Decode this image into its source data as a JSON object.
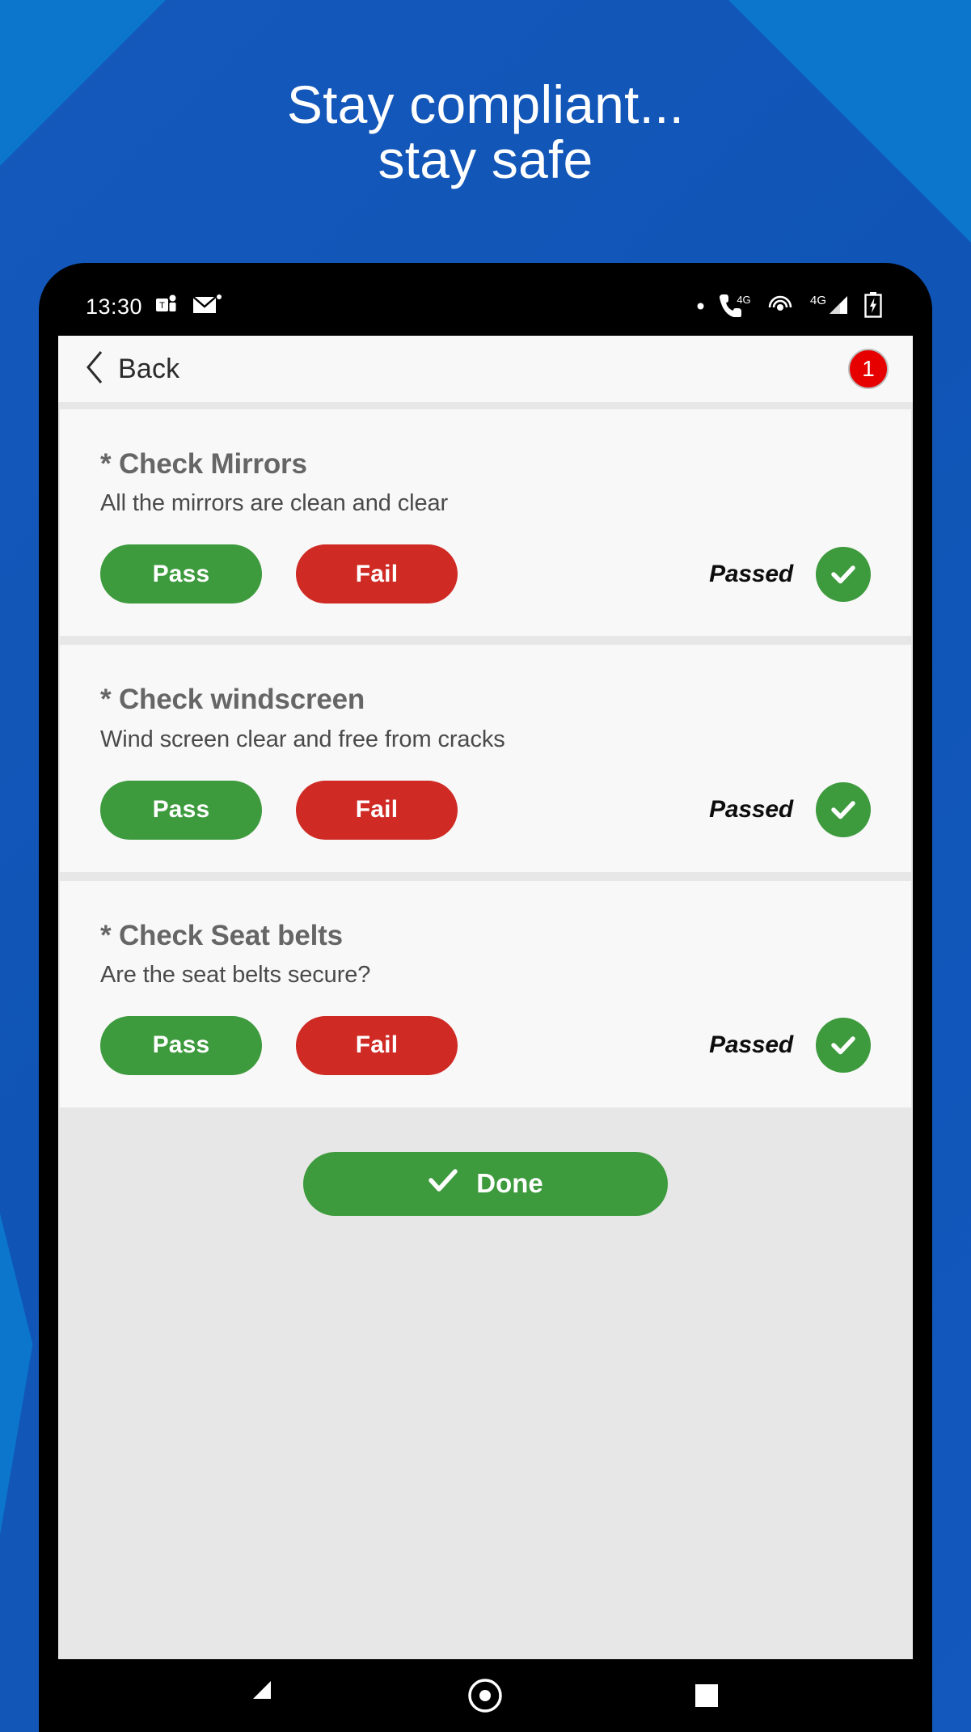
{
  "promo": {
    "headline": "Stay compliant...\nstay safe",
    "bg_color": "#1257b8",
    "accent_color": "#0b76cc"
  },
  "status_bar": {
    "time": "13:30",
    "left_icons": [
      "teams-icon",
      "envelope-icon",
      "dot-icon"
    ],
    "right_icons": [
      "dot-icon",
      "phone-4g-icon",
      "hotspot-icon",
      "signal-4g-icon",
      "battery-charging-icon"
    ],
    "network_label": "4G",
    "network_label_2": "4G"
  },
  "app_header": {
    "back_label": "Back",
    "back_icon": "chevron-left-icon",
    "badge_count": "1",
    "badge_color": "#e60000"
  },
  "checklist": {
    "items": [
      {
        "title": "* Check Mirrors",
        "description": "All the mirrors are clean and clear",
        "pass_label": "Pass",
        "fail_label": "Fail",
        "status": "Passed",
        "status_icon": "check-circle-icon"
      },
      {
        "title": "* Check windscreen",
        "description": "Wind screen clear and free from cracks",
        "pass_label": "Pass",
        "fail_label": "Fail",
        "status": "Passed",
        "status_icon": "check-circle-icon"
      },
      {
        "title": "* Check Seat belts",
        "description": "Are the seat belts secure?",
        "pass_label": "Pass",
        "fail_label": "Fail",
        "status": "Passed",
        "status_icon": "check-circle-icon"
      }
    ]
  },
  "footer": {
    "done_label": "Done",
    "done_icon": "check-icon",
    "done_color": "#3d9a3d"
  },
  "nav_bar": {
    "back_icon": "nav-back-triangle-icon",
    "home_icon": "nav-home-circle-icon",
    "recents_icon": "nav-recents-square-icon"
  },
  "colors": {
    "pass": "#3d9a3d",
    "fail": "#cf2a24",
    "card": "#f8f8f8",
    "app_bg": "#e6e7e6"
  }
}
